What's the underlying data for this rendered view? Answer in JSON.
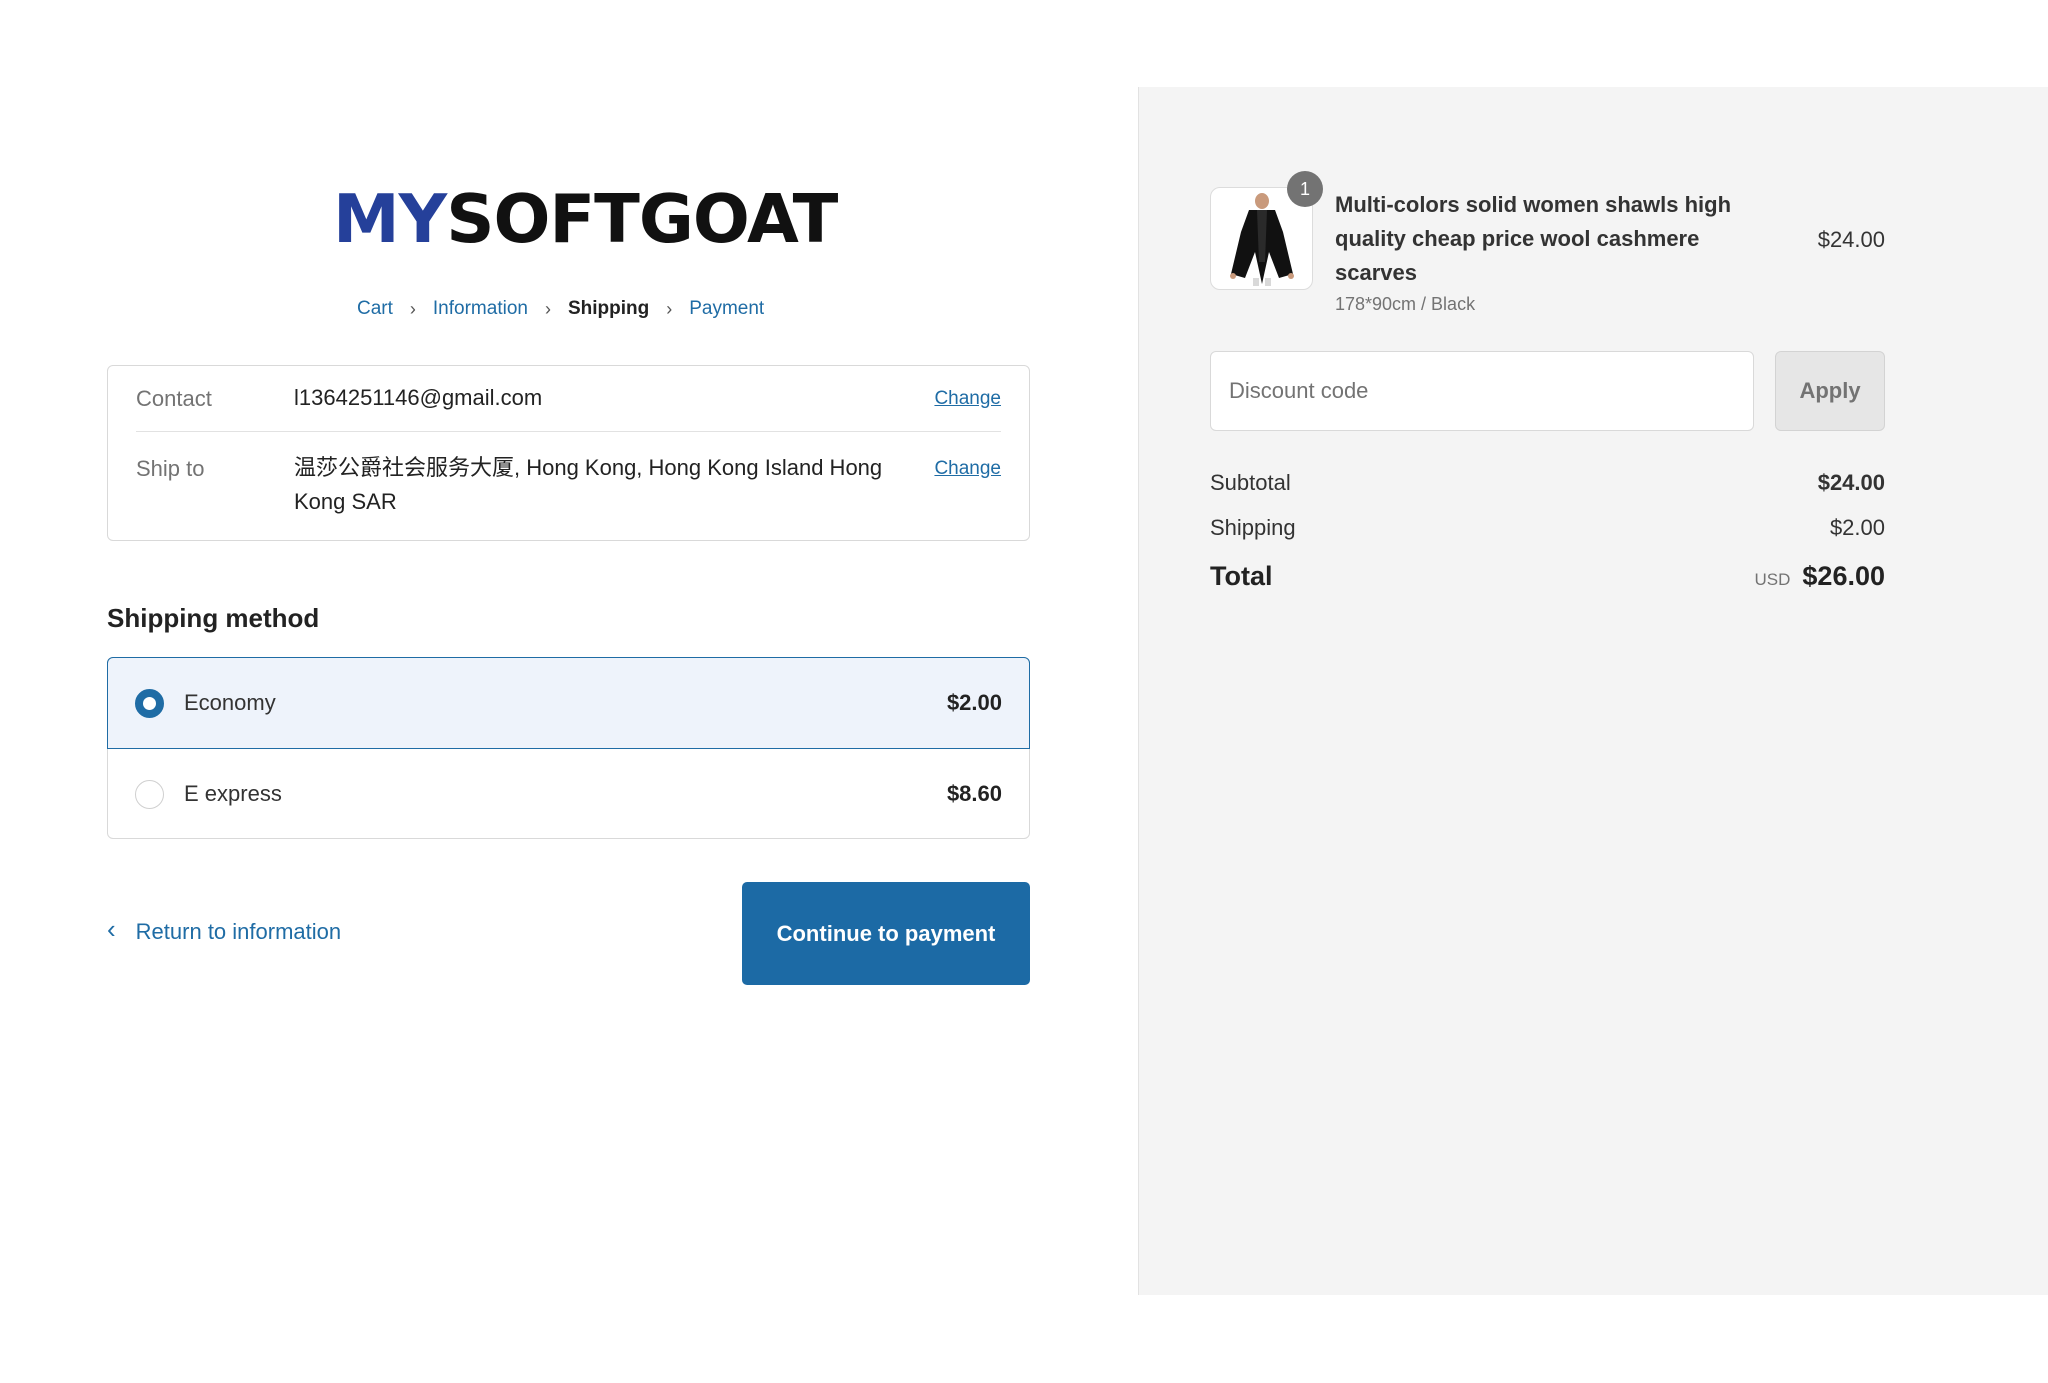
{
  "brand": {
    "logo_part1": "MY",
    "logo_part2": "SOFTGOAT",
    "logo_color": "#25409a"
  },
  "breadcrumb": {
    "items": [
      {
        "label": "Cart",
        "state": "link"
      },
      {
        "label": "Information",
        "state": "link"
      },
      {
        "label": "Shipping",
        "state": "current"
      },
      {
        "label": "Payment",
        "state": "link"
      }
    ],
    "separator_icon": "chevron-right-icon"
  },
  "review": {
    "contact_label": "Contact",
    "contact_value": "l1364251146@gmail.com",
    "contact_change": "Change",
    "shipto_label": "Ship to",
    "shipto_value": "温莎公爵社会服务大厦, Hong Kong, Hong Kong Island Hong Kong SAR",
    "shipto_change": "Change"
  },
  "shipping_method": {
    "title": "Shipping method",
    "options": [
      {
        "name": "Economy",
        "price": "$2.00",
        "selected": true
      },
      {
        "name": "E express",
        "price": "$8.60",
        "selected": false
      }
    ]
  },
  "actions": {
    "return_label": "Return to information",
    "return_icon": "chevron-left-icon",
    "continue_label": "Continue to payment"
  },
  "order_summary": {
    "product": {
      "quantity": "1",
      "title": "Multi-colors solid women shawls high quality cheap price wool cashmere scarves",
      "variant": "178*90cm / Black",
      "price": "$24.00",
      "image_icon": "black-shawl-image"
    },
    "discount": {
      "placeholder": "Discount code",
      "apply_label": "Apply"
    },
    "subtotal_label": "Subtotal",
    "subtotal_value": "$24.00",
    "shipping_label": "Shipping",
    "shipping_value": "$2.00",
    "total_label": "Total",
    "total_currency": "USD",
    "total_value": "$26.00"
  },
  "colors": {
    "accent": "#1c6aa5",
    "selected_bg": "#eef3fb",
    "summary_bg": "#f4f4f4"
  }
}
